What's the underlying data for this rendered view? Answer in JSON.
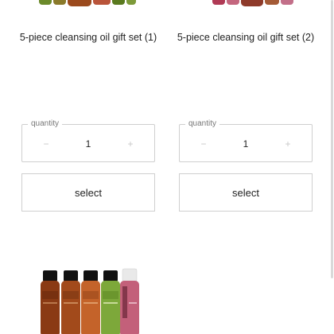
{
  "products": [
    {
      "title": "5-piece cleansing oil gift set (1)",
      "quantity_label": "quantity",
      "quantity_value": "1",
      "minus_symbol": "−",
      "plus_symbol": "+",
      "select_label": "select",
      "bottle_colors": [
        "#6b8a2a",
        "#8a5a24",
        "#9b4a1d",
        "#b9543a",
        "#5a7a1f",
        "#a12c47"
      ]
    },
    {
      "title": "5-piece cleansing oil gift set (2)",
      "quantity_label": "quantity",
      "quantity_value": "1",
      "minus_symbol": "−",
      "plus_symbol": "+",
      "select_label": "select",
      "bottle_colors": [
        "#b03a55",
        "#c4667e",
        "#8e3a2a",
        "#a45a36",
        "#c26f89"
      ]
    }
  ],
  "gift_set_image": {
    "bottle_colors": {
      "amber_dark": "#7a3714",
      "amber": "#a24a1b",
      "amber_light": "#c4632a",
      "green": "#7da83a",
      "pink": "#c3607a",
      "cap_black": "#111111",
      "cap_white": "#e9e9e9"
    }
  },
  "colors": {
    "border": "#cfcfcf",
    "text": "#222222",
    "muted": "#777777"
  }
}
